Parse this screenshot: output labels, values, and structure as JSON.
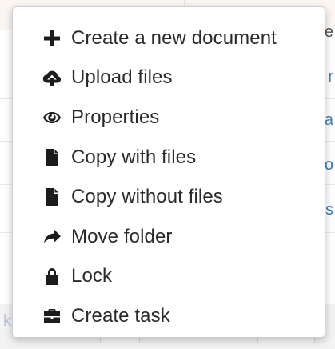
{
  "background": {
    "right_fragments": [
      "e",
      "r",
      "a",
      "o",
      "s"
    ],
    "left_fragment": "k"
  },
  "context_menu": {
    "items": [
      {
        "label": "Create a new document",
        "icon": "plus-icon"
      },
      {
        "label": "Upload files",
        "icon": "cloud-upload-icon"
      },
      {
        "label": "Properties",
        "icon": "eye-icon"
      },
      {
        "label": "Copy with files",
        "icon": "file-icon"
      },
      {
        "label": "Copy without files",
        "icon": "file-icon"
      },
      {
        "label": "Move folder",
        "icon": "share-arrow-icon"
      },
      {
        "label": "Lock",
        "icon": "lock-icon"
      },
      {
        "label": "Create task",
        "icon": "briefcase-icon"
      }
    ]
  }
}
